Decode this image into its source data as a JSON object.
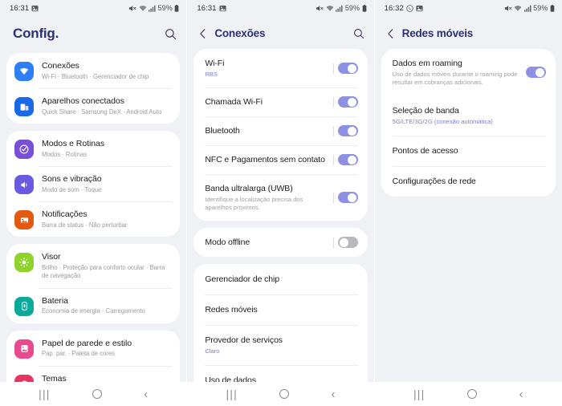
{
  "theme": {
    "page_bg": "#f0f1f5",
    "card_bg": "#ffffff",
    "header_text": "#2b2f7a",
    "toggle_on": "#8d91e3",
    "toggle_off": "#b9b9bd",
    "accent_sub": "#7b7fd0"
  },
  "panel1": {
    "status": {
      "time": "16:31",
      "battery": "59%",
      "icons": [
        "mute-icon",
        "wifi-icon",
        "signal-icon",
        "battery-icon",
        "gallery-icon"
      ]
    },
    "header": {
      "title": "Config.",
      "search_icon": "search-icon"
    },
    "groups": [
      {
        "items": [
          {
            "title": "Conexões",
            "sub": "Wi-Fi · Bluetooth · Gerenciador de chip",
            "icon": "wifi-icon",
            "color": "#2e7ef7"
          },
          {
            "title": "Aparelhos conectados",
            "sub": "Quick Share · Samsung DeX · Android Auto",
            "icon": "devices-icon",
            "color": "#1769e8"
          }
        ]
      },
      {
        "items": [
          {
            "title": "Modos e Rotinas",
            "sub": "Modos · Rotinas",
            "icon": "modes-icon",
            "color": "#7a4fd8"
          },
          {
            "title": "Sons e vibração",
            "sub": "Modo de som · Toque",
            "icon": "sound-icon",
            "color": "#6a5ae0"
          },
          {
            "title": "Notificações",
            "sub": "Barra de status · Não perturbar",
            "icon": "notifications-icon",
            "color": "#e3590f"
          }
        ]
      },
      {
        "items": [
          {
            "title": "Visor",
            "sub": "Brilho · Proteção para conforto ocular · Barra de navegação",
            "icon": "display-icon",
            "color": "#8ed22a"
          },
          {
            "title": "Bateria",
            "sub": "Economia de energia · Carregamento",
            "icon": "battery-icon",
            "color": "#0aa99a"
          }
        ]
      },
      {
        "items": [
          {
            "title": "Papel de parede e estilo",
            "sub": "Pap. par. · Paleta de cores",
            "icon": "wallpaper-icon",
            "color": "#e8498f"
          },
          {
            "title": "Temas",
            "sub": "",
            "icon": "themes-icon",
            "color": "#e8325f"
          }
        ]
      }
    ]
  },
  "panel2": {
    "status": {
      "time": "16:31",
      "battery": "59%"
    },
    "header": {
      "title": "Conexões",
      "back_icon": "back-chevron-icon",
      "search_icon": "search-icon"
    },
    "group1": [
      {
        "title": "Wi-Fi",
        "sub": "RBS",
        "sub_accent": true,
        "toggle": "on"
      },
      {
        "title": "Chamada Wi-Fi",
        "sub": "",
        "toggle": "on"
      },
      {
        "title": "Bluetooth",
        "sub": "",
        "toggle": "on"
      },
      {
        "title": "NFC e Pagamentos sem contato",
        "sub": "",
        "toggle": "on"
      },
      {
        "title": "Banda ultralarga (UWB)",
        "sub": "Identifique a localização precisa dos aparelhos próximos.",
        "toggle": "on"
      }
    ],
    "group2": [
      {
        "title": "Modo offline",
        "sub": "",
        "toggle": "off"
      }
    ],
    "group3": [
      {
        "title": "Gerenciador de chip",
        "sub": ""
      },
      {
        "title": "Redes móveis",
        "sub": ""
      },
      {
        "title": "Provedor de serviços",
        "sub": "Claro",
        "sub_accent": true
      },
      {
        "title": "Uso de dados",
        "sub": ""
      }
    ]
  },
  "panel3": {
    "status": {
      "time": "16:32",
      "battery": "59%",
      "icons": [
        "whatsapp-icon",
        "gallery-icon"
      ]
    },
    "header": {
      "title": "Redes móveis",
      "back_icon": "back-chevron-icon"
    },
    "items": [
      {
        "title": "Dados em roaming",
        "sub": "Uso de dados móveis durante o roaming pode resultar em cobranças adicionais.",
        "toggle": "on"
      },
      {
        "title": "Seleção de banda",
        "sub": "5G/LTE/3G/2G (conexão automática)",
        "sub_accent": true
      },
      {
        "title": "Pontos de acesso",
        "sub": ""
      },
      {
        "title": "Configurações de rede",
        "sub": ""
      }
    ]
  },
  "navbar": {
    "recent_label": "|||",
    "home_label": "",
    "back_label": "‹"
  }
}
